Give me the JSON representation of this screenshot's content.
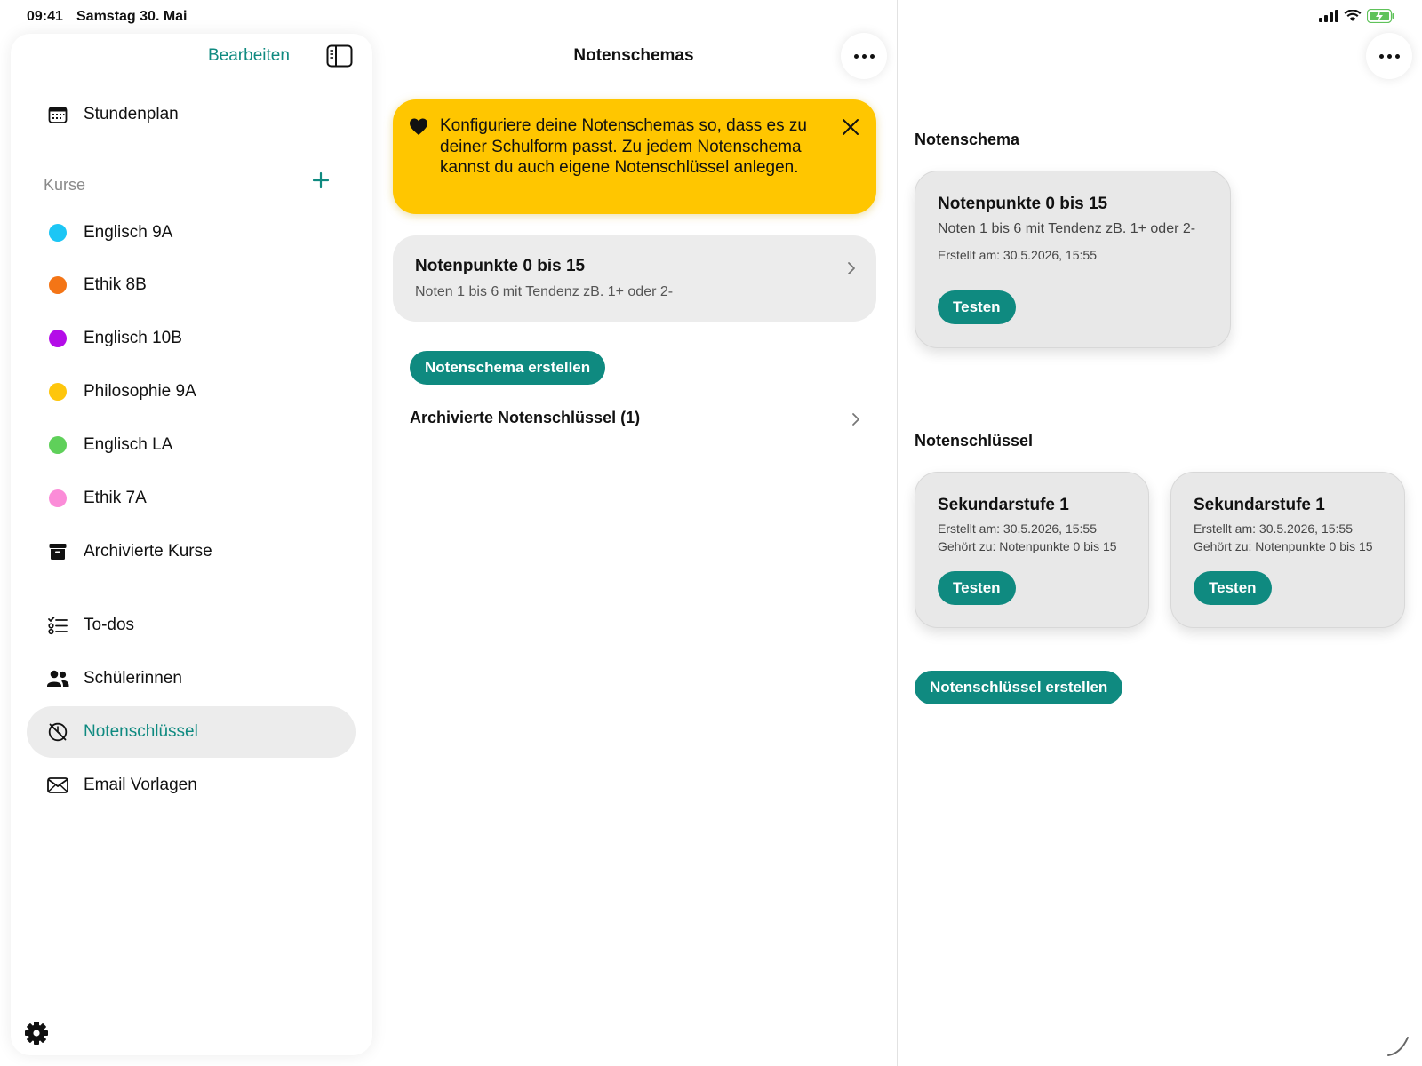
{
  "status_bar": {
    "time": "09:41",
    "date": "Samstag 30. Mai"
  },
  "colors": {
    "accent": "#0f8a80",
    "banner": "#ffc600",
    "card": "#ececec"
  },
  "sidebar": {
    "edit_label": "Bearbeiten",
    "toggle_icon": "sidebar-toggle-icon",
    "top_items": [
      {
        "label": "Stundenplan",
        "icon": "calendar-icon"
      }
    ],
    "courses_section": {
      "label": "Kurse",
      "add_icon": "plus-icon",
      "items": [
        {
          "label": "Englisch 9A",
          "color": "#1cc6f5"
        },
        {
          "label": "Ethik 8B",
          "color": "#f47516"
        },
        {
          "label": "Englisch 10B",
          "color": "#b40de8"
        },
        {
          "label": "Philosophie 9A",
          "color": "#fec60c"
        },
        {
          "label": "Englisch LA",
          "color": "#5fd05a"
        },
        {
          "label": "Ethik 7A",
          "color": "#fb8cd8"
        }
      ],
      "archived": {
        "label": "Archivierte Kurse",
        "icon": "archive-box-icon"
      }
    },
    "bottom_items": [
      {
        "label": "To-dos",
        "icon": "checklist-icon",
        "active": false
      },
      {
        "label": "Schülerinnen",
        "icon": "people-icon",
        "active": false
      },
      {
        "label": "Notenschlüssel",
        "icon": "gauge-off-icon",
        "active": true
      },
      {
        "label": "Email Vorlagen",
        "icon": "envelope-icon",
        "active": false
      }
    ],
    "settings_icon": "gear-icon"
  },
  "middle": {
    "title": "Notenschemas",
    "banner": {
      "text": "Konfiguriere deine Notenschemas so, dass es zu deiner Schulform passt. Zu jedem Notenschema kannst du auch eigene Notenschlüssel anlegen.",
      "icon": "heart-icon",
      "close_icon": "close-icon"
    },
    "schema_card": {
      "title": "Notenpunkte 0 bis 15",
      "subtitle": "Noten 1 bis 6 mit Tendenz zB. 1+ oder 2-"
    },
    "create_button": "Notenschema erstellen",
    "archive_link": "Archivierte Notenschlüssel (1)"
  },
  "detail": {
    "schema_section_label": "Notenschema",
    "schema_tile": {
      "title": "Notenpunkte 0 bis 15",
      "subtitle": "Noten 1 bis 6 mit Tendenz zB. 1+ oder 2-",
      "created": "Erstellt am: 30.5.2026, 15:55",
      "button": "Testen"
    },
    "keys_section_label": "Notenschlüssel",
    "key_tiles": [
      {
        "title": "Sekundarstufe 1",
        "created": "Erstellt am: 30.5.2026, 15:55",
        "belongs": "Gehört zu: Notenpunkte 0 bis 15",
        "button": "Testen"
      },
      {
        "title": "Sekundarstufe 1",
        "created": "Erstellt am: 30.5.2026, 15:55",
        "belongs": "Gehört zu: Notenpunkte 0 bis 15",
        "button": "Testen"
      }
    ],
    "create_key_button": "Notenschlüssel erstellen"
  }
}
